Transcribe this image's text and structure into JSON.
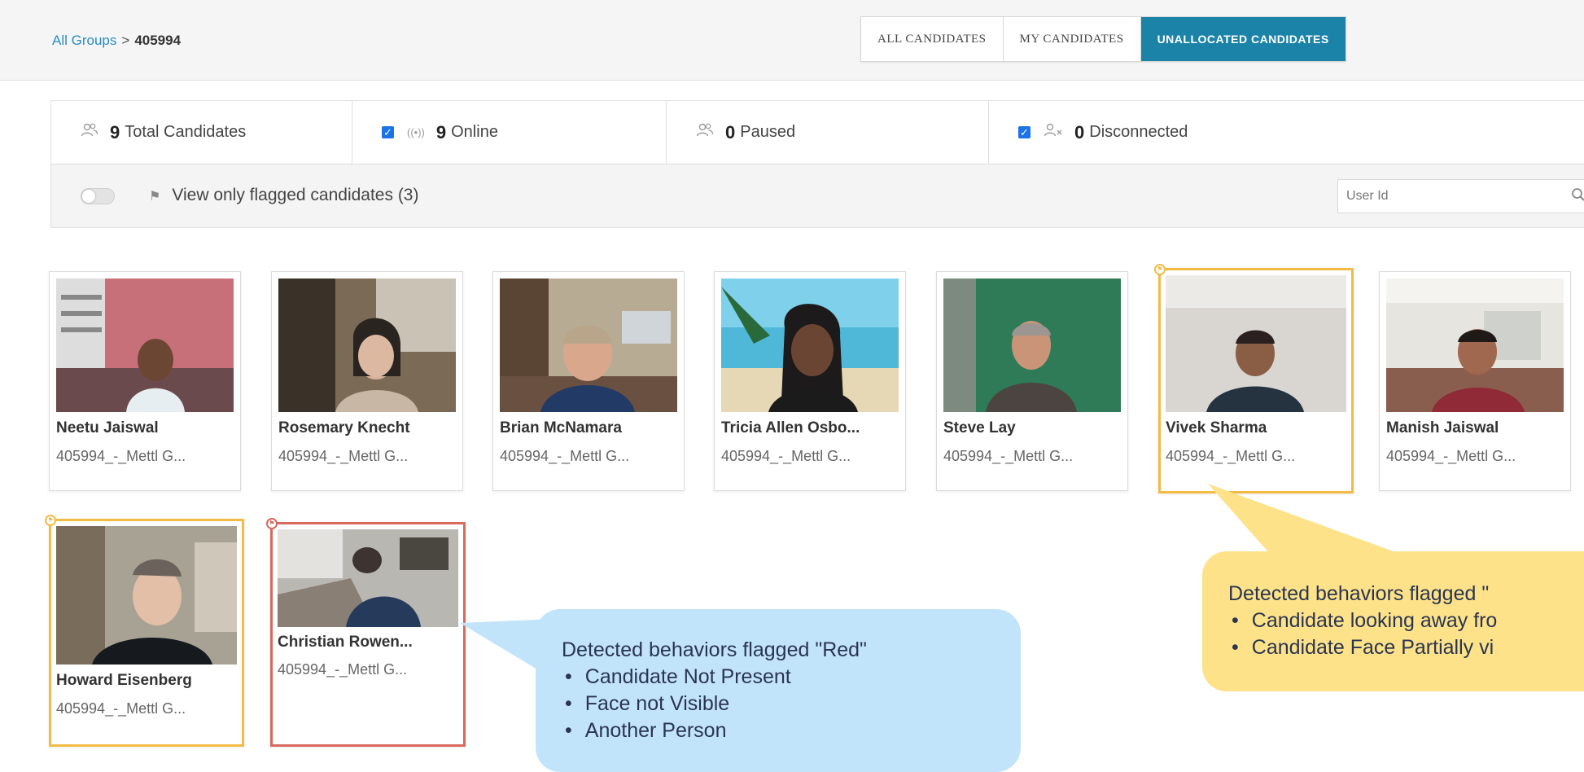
{
  "breadcrumb": {
    "root": "All Groups",
    "separator": ">",
    "current": "405994"
  },
  "tabs": [
    {
      "label": "ALL CANDIDATES",
      "active": false
    },
    {
      "label": "MY CANDIDATES",
      "active": false
    },
    {
      "label": "UNALLOCATED CANDIDATES",
      "active": true
    }
  ],
  "stats": {
    "total": {
      "count": "9",
      "label": "Total Candidates",
      "icon": "users-icon"
    },
    "online": {
      "count": "9",
      "label": "Online",
      "checked": true,
      "icon": "broadcast-icon"
    },
    "paused": {
      "count": "0",
      "label": "Paused",
      "icon": "users-icon"
    },
    "disconnected": {
      "count": "0",
      "label": "Disconnected",
      "checked": true,
      "icon": "user-x-icon"
    }
  },
  "filter": {
    "flagged_label": "View only flagged candidates (3)",
    "toggle_on": false
  },
  "search": {
    "placeholder": "User Id"
  },
  "candidates": [
    {
      "name": "Neetu Jaiswal",
      "group": "405994_-_Mettl G...",
      "flag": "none"
    },
    {
      "name": "Rosemary Knecht",
      "group": "405994_-_Mettl G...",
      "flag": "none"
    },
    {
      "name": "Brian McNamara",
      "group": "405994_-_Mettl G...",
      "flag": "none"
    },
    {
      "name": "Tricia Allen Osbo...",
      "group": "405994_-_Mettl G...",
      "flag": "none"
    },
    {
      "name": "Steve Lay",
      "group": "405994_-_Mettl G...",
      "flag": "none"
    },
    {
      "name": "Vivek Sharma",
      "group": "405994_-_Mettl G...",
      "flag": "yellow"
    },
    {
      "name": "Manish Jaiswal",
      "group": "405994_-_Mettl G...",
      "flag": "none"
    },
    {
      "name": "Howard Eisenberg",
      "group": "405994_-_Mettl G...",
      "flag": "yellow"
    },
    {
      "name": "Christian Rowen...",
      "group": "405994_-_Mettl G...",
      "flag": "red"
    }
  ],
  "callouts": {
    "red": {
      "title": "Detected behaviors flagged \"Red\"",
      "items": [
        "Candidate Not Present",
        "Face not Visible",
        "Another Person"
      ]
    },
    "yellow": {
      "title": "Detected behaviors flagged \"",
      "items": [
        "Candidate looking away fro",
        "Candidate Face Partially vi"
      ]
    }
  },
  "colors": {
    "accent": "#1b83a8",
    "link": "#2a8cc4",
    "flag_yellow": "#f2bb45",
    "flag_red": "#d8695c"
  }
}
